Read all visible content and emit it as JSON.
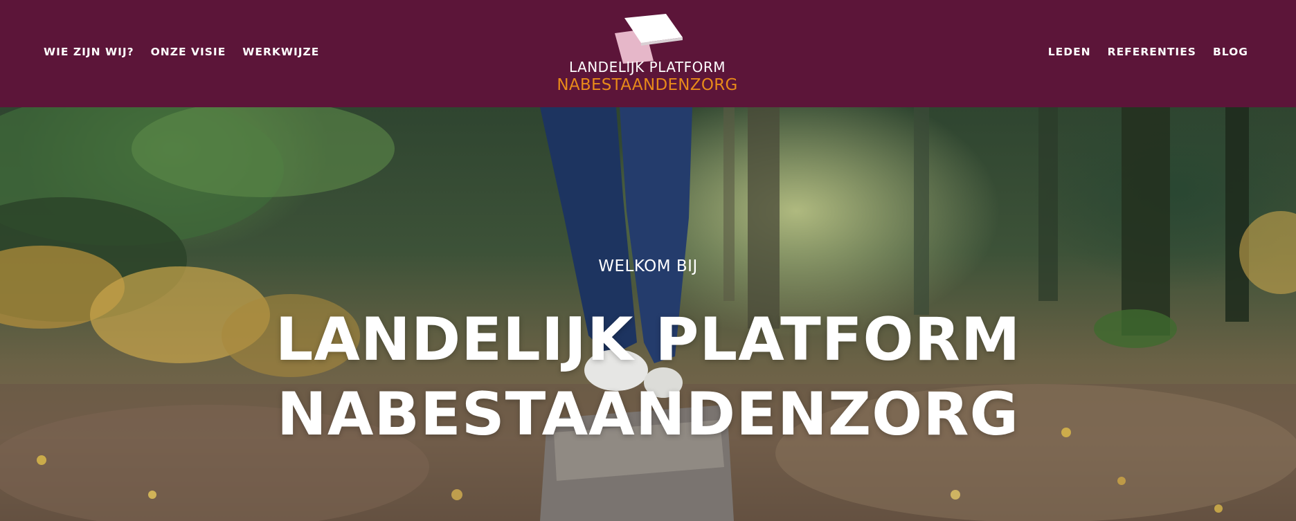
{
  "header": {
    "background_color": "#5c1539",
    "nav_left": [
      {
        "label": "WIE ZIJN WIJ?"
      },
      {
        "label": "ONZE VISIE"
      },
      {
        "label": "WERKWIJZE"
      }
    ],
    "nav_right": [
      {
        "label": "LEDEN"
      },
      {
        "label": "REFERENTIES"
      },
      {
        "label": "BLOG"
      }
    ],
    "logo": {
      "line1": "LANDELIJK PLATFORM",
      "line2": "NABESTAANDENZORG",
      "line2_color": "#e88a1a",
      "icon": "stacked-pages-icon"
    }
  },
  "hero": {
    "subtitle": "WELKOM BIJ",
    "title_line1": "LANDELIJK PLATFORM",
    "title_line2": "NABESTAANDENZORG",
    "image": "forest-path-person-walking-on-log"
  }
}
